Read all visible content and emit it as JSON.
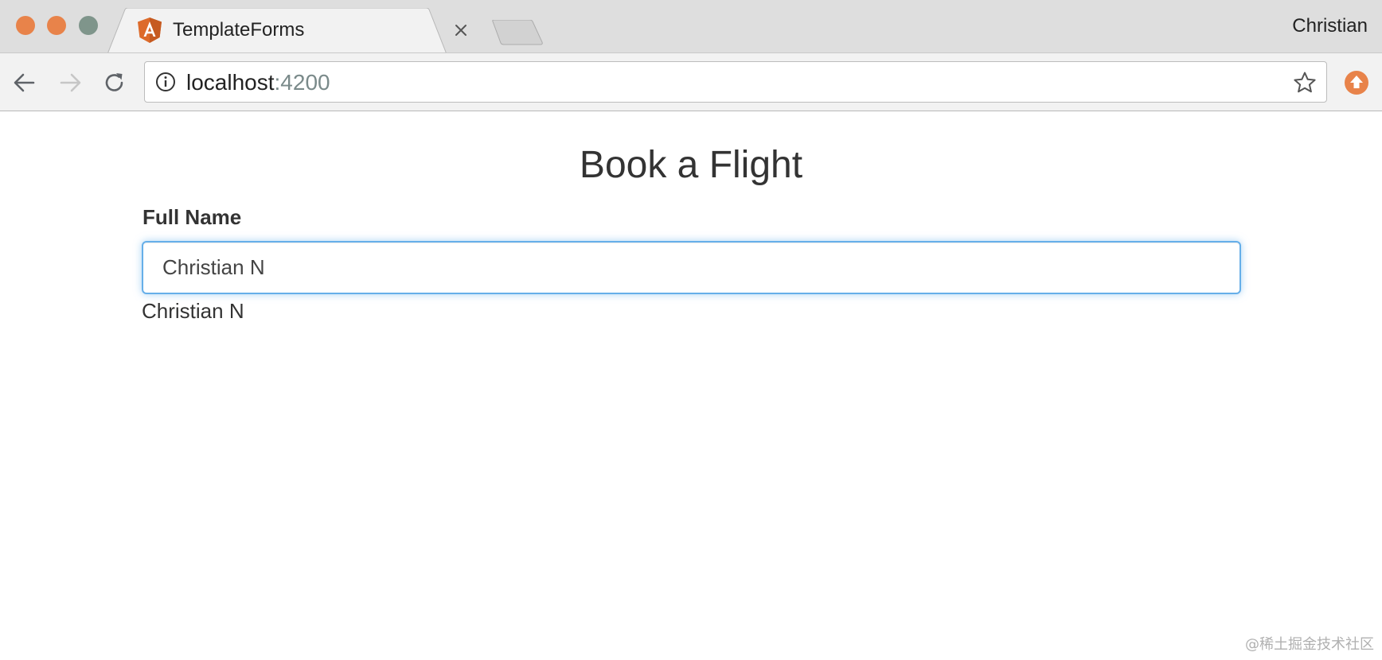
{
  "window": {
    "controls": [
      "close",
      "minimize",
      "maximize"
    ],
    "profile_name": "Christian"
  },
  "tabs": [
    {
      "title": "TemplateForms",
      "favicon": "angular-icon",
      "active": true
    }
  ],
  "toolbar": {
    "url_host": "localhost",
    "url_port": ":4200",
    "icons": [
      "back-arrow-icon",
      "forward-arrow-icon",
      "reload-icon",
      "info-icon",
      "star-icon",
      "extension-upload-icon"
    ]
  },
  "form": {
    "title": "Book a Flight",
    "full_name_label": "Full Name",
    "full_name_value": "Christian N",
    "echo_value": "Christian N"
  },
  "watermark": "@稀土掘金技术社区",
  "colors": {
    "accent_orange": "#e8834a",
    "input_focus": "#66afe9",
    "url_port": "#7a8a8a"
  }
}
